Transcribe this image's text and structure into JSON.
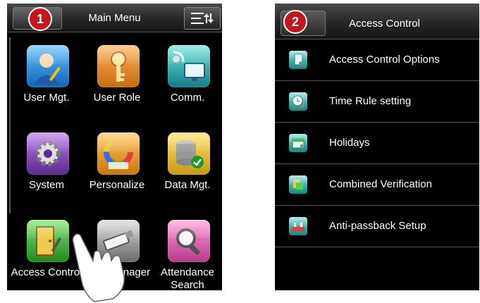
{
  "left": {
    "badge": "1",
    "title": "Main Menu",
    "tiles": [
      {
        "label": "User Mgt.",
        "icon": "user-icon"
      },
      {
        "label": "User Role",
        "icon": "key-icon"
      },
      {
        "label": "Comm.",
        "icon": "satellite-computer-icon"
      },
      {
        "label": "System",
        "icon": "gear-icon"
      },
      {
        "label": "Personalize",
        "icon": "color-wheel-icon"
      },
      {
        "label": "Data Mgt.",
        "icon": "database-check-icon"
      },
      {
        "label": "Access Control",
        "icon": "door-icon"
      },
      {
        "label": "USB Manager",
        "icon": "usb-drive-icon"
      },
      {
        "label": "Attendance Search",
        "icon": "magnifier-icon"
      }
    ]
  },
  "right": {
    "badge": "2",
    "title": "Access Control",
    "items": [
      {
        "label": "Access Control Options",
        "icon": "options-doc-icon"
      },
      {
        "label": "Time Rule setting",
        "icon": "clock-gear-icon"
      },
      {
        "label": "Holidays",
        "icon": "calendar-icon"
      },
      {
        "label": "Combined Verification",
        "icon": "combined-verify-icon"
      },
      {
        "label": "Anti-passback Setup",
        "icon": "anti-passback-icon"
      }
    ]
  }
}
